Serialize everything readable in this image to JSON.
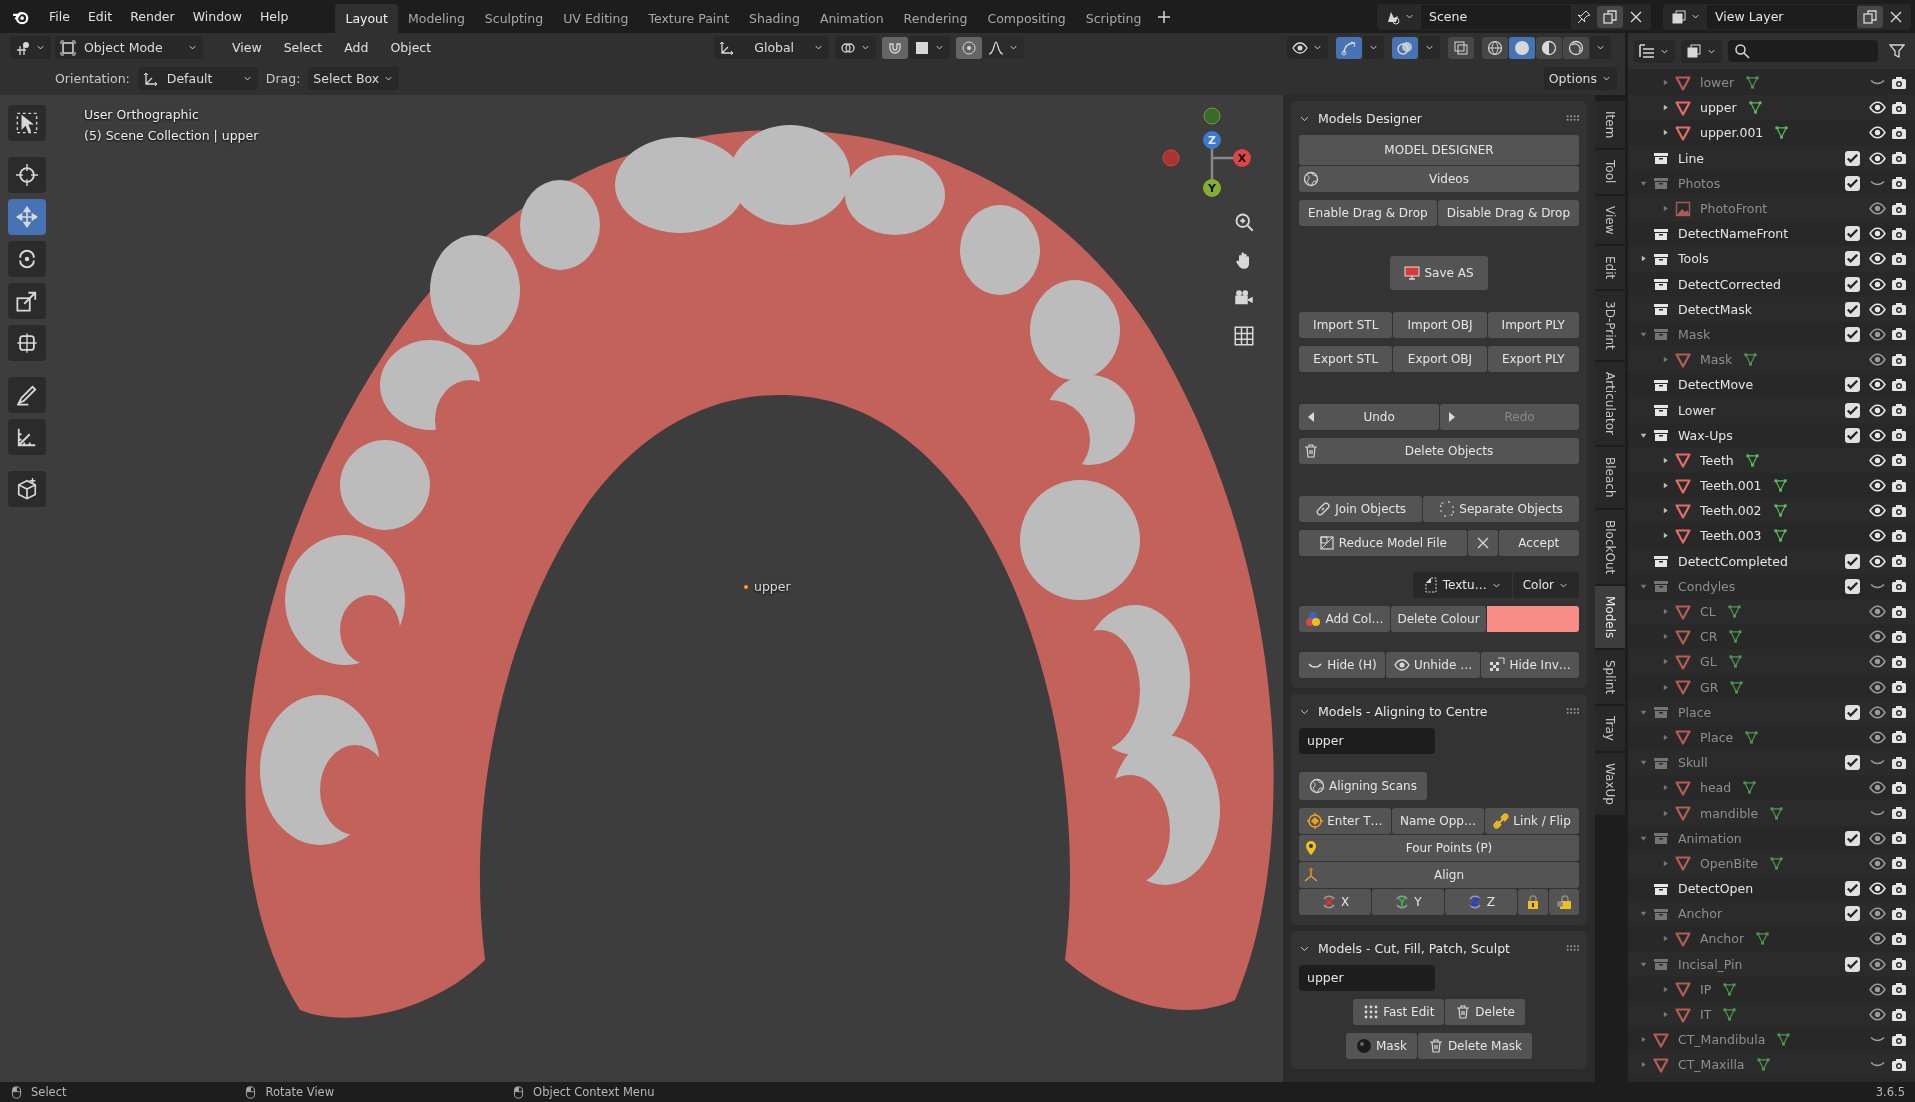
{
  "top_bar": {
    "menus": [
      "File",
      "Edit",
      "Render",
      "Window",
      "Help"
    ],
    "workspaces": [
      {
        "label": "Layout",
        "selected": true
      },
      {
        "label": "Modeling",
        "selected": false
      },
      {
        "label": "Sculpting",
        "selected": false
      },
      {
        "label": "UV Editing",
        "selected": false
      },
      {
        "label": "Texture Paint",
        "selected": false
      },
      {
        "label": "Shading",
        "selected": false
      },
      {
        "label": "Animation",
        "selected": false
      },
      {
        "label": "Rendering",
        "selected": false
      },
      {
        "label": "Compositing",
        "selected": false
      },
      {
        "label": "Scripting",
        "selected": false
      }
    ],
    "scene": "Scene",
    "view_layer": "View Layer"
  },
  "viewport_header": {
    "mode": "Object Mode",
    "menus": [
      "View",
      "Select",
      "Add",
      "Object"
    ],
    "orientation": "Global",
    "gizmos_on": true,
    "overlays_on": true,
    "shading": [
      {
        "selected": false
      },
      {
        "selected": true
      },
      {
        "selected": false
      },
      {
        "selected": false
      }
    ]
  },
  "tool_settings": {
    "orientation_label": "Orientation:",
    "orientation": "Default",
    "drag_label": "Drag:",
    "drag": "Select Box",
    "options": "Options"
  },
  "toolbar": [
    {
      "selected": false
    },
    {
      "selected": false
    },
    {
      "selected": true
    },
    {
      "selected": false
    },
    {
      "selected": false
    },
    {
      "selected": false
    },
    {
      "selected": false
    },
    {
      "selected": false
    },
    {
      "selected": false
    }
  ],
  "viewport": {
    "view_name": "User Orthographic",
    "collection_info": "(5) Scene Collection | upper",
    "object_label": "upper",
    "axes": [
      "Z",
      "X",
      "Y"
    ]
  },
  "n_panel": {
    "sections": [
      {
        "title": "Models Designer",
        "expanded": true,
        "rows": [
          {
            "kind": "stack",
            "rows": [
              [
                {
                  "label": "MODEL DESIGNER"
                }
              ],
              [
                {
                  "label": "Videos"
                }
              ]
            ]
          },
          {
            "kind": "row",
            "buttons": [
              {
                "label": "Enable Drag & Drop"
              },
              {
                "label": "Disable Drag & Drop"
              }
            ]
          },
          {
            "kind": "center",
            "buttons": [
              {
                "label": "Save AS"
              }
            ]
          },
          {
            "kind": "row",
            "buttons": [
              {
                "label": "Import STL"
              },
              {
                "label": "Import OBJ"
              },
              {
                "label": "Import PLY"
              }
            ]
          },
          {
            "kind": "row",
            "buttons": [
              {
                "label": "Export STL"
              },
              {
                "label": "Export OBJ"
              },
              {
                "label": "Export PLY"
              }
            ]
          },
          {
            "kind": "row",
            "buttons": [
              {
                "label": "Undo",
                "disabled": false
              },
              {
                "label": "Redo",
                "disabled": true
              }
            ]
          },
          {
            "kind": "row",
            "buttons": [
              {
                "label": "Delete Objects"
              }
            ]
          },
          {
            "kind": "row",
            "buttons": [
              {
                "label": "Join Objects"
              },
              {
                "label": "Separate Objects"
              }
            ]
          },
          {
            "kind": "row",
            "buttons": [
              {
                "label": "Reduce Model File"
              },
              {
                "kind": "icon"
              },
              {
                "label": "Accept"
              }
            ]
          },
          {
            "kind": "right",
            "buttons": [
              {
                "kind": "dropdown",
                "label": "Textu…"
              },
              {
                "kind": "dropdown",
                "label": "Color"
              }
            ]
          },
          {
            "kind": "row",
            "buttons": [
              {
                "label": "Add Col…"
              },
              {
                "label": "Delete Colour"
              },
              {
                "kind": "swatch",
                "color": "#f88d87"
              }
            ]
          },
          {
            "kind": "row",
            "buttons": [
              {
                "label": "Hide (H)"
              },
              {
                "label": "Unhide …"
              },
              {
                "label": "Hide Inv…"
              }
            ]
          }
        ]
      },
      {
        "title": "Models - Aligning to Centre",
        "expanded": true,
        "rows": [
          {
            "kind": "field",
            "value": "upper"
          },
          {
            "kind": "left",
            "buttons": [
              {
                "label": "Aligning Scans"
              }
            ]
          },
          {
            "kind": "stack",
            "rows": [
              [
                {
                  "label": "Enter T…"
                },
                {
                  "label": "Name Opp…"
                },
                {
                  "label": "Link / Flip"
                }
              ],
              [
                {
                  "label": "Four Points (P)"
                }
              ],
              [
                {
                  "label": "Align"
                }
              ],
              [
                {
                  "label": "X"
                },
                {
                  "label": "Y"
                },
                {
                  "label": "Z"
                },
                {
                  "kind": "icon"
                },
                {
                  "kind": "icon"
                }
              ]
            ]
          }
        ]
      },
      {
        "title": "Models - Cut, Fill, Patch, Sculpt",
        "expanded": true,
        "rows": [
          {
            "kind": "field",
            "value": "upper"
          },
          {
            "kind": "center",
            "buttons": [
              {
                "label": "Fast Edit"
              },
              {
                "label": "Delete"
              }
            ]
          },
          {
            "kind": "center",
            "buttons": [
              {
                "label": "Mask"
              },
              {
                "label": "Delete Mask"
              }
            ]
          }
        ]
      }
    ]
  },
  "side_tabs": [
    {
      "label": "Item",
      "selected": false
    },
    {
      "label": "Tool",
      "selected": false
    },
    {
      "label": "View",
      "selected": false
    },
    {
      "label": "Edit",
      "selected": false
    },
    {
      "label": "3D-Print",
      "selected": false
    },
    {
      "label": "Articulator",
      "selected": false
    },
    {
      "label": "Bleach",
      "selected": false
    },
    {
      "label": "BlockOut",
      "selected": false
    },
    {
      "label": "Models",
      "selected": true
    },
    {
      "label": "Splint",
      "selected": false
    },
    {
      "label": "Tray",
      "selected": false
    },
    {
      "label": "WaxUp",
      "selected": false
    }
  ],
  "outliner": {
    "partial_children": [
      {
        "kind": "mesh",
        "name": "lower",
        "expanded": false,
        "dim": true,
        "visible": false
      },
      {
        "kind": "mesh",
        "name": "upper",
        "expanded": false,
        "dim": false,
        "visible": true
      },
      {
        "kind": "mesh",
        "name": "upper.001",
        "expanded": false,
        "dim": false,
        "visible": true
      }
    ],
    "items": [
      {
        "kind": "collection",
        "name": "Line",
        "checked": true,
        "dim": false,
        "visible": true
      },
      {
        "kind": "collection",
        "name": "Photos",
        "expanded": true,
        "checked": true,
        "dim": true,
        "visible": false,
        "children": [
          {
            "kind": "image",
            "name": "PhotoFront",
            "expanded": false,
            "dim": true,
            "visible": true
          }
        ]
      },
      {
        "kind": "collection",
        "name": "DetectNameFront",
        "checked": true,
        "dim": false,
        "visible": true
      },
      {
        "kind": "collection",
        "name": "Tools",
        "expanded": false,
        "checked": true,
        "dim": false,
        "visible": true
      },
      {
        "kind": "collection",
        "name": "DetectCorrected",
        "checked": true,
        "dim": false,
        "visible": true
      },
      {
        "kind": "collection",
        "name": "DetectMask",
        "checked": true,
        "dim": false,
        "visible": true
      },
      {
        "kind": "collection",
        "name": "Mask",
        "expanded": true,
        "checked": true,
        "dim": true,
        "visible": true,
        "children": [
          {
            "kind": "mesh",
            "name": "Mask",
            "expanded": false,
            "dim": true,
            "visible": true
          }
        ]
      },
      {
        "kind": "collection",
        "name": "DetectMove",
        "checked": true,
        "dim": false,
        "visible": true
      },
      {
        "kind": "collection",
        "name": "Lower",
        "checked": true,
        "dim": false,
        "visible": true
      },
      {
        "kind": "collection",
        "name": "Wax-Ups",
        "expanded": true,
        "checked": true,
        "dim": false,
        "visible": true,
        "children": [
          {
            "kind": "mesh",
            "name": "Teeth",
            "expanded": false,
            "dim": false,
            "visible": true
          },
          {
            "kind": "mesh",
            "name": "Teeth.001",
            "expanded": false,
            "dim": false,
            "visible": true
          },
          {
            "kind": "mesh",
            "name": "Teeth.002",
            "expanded": false,
            "dim": false,
            "visible": true
          },
          {
            "kind": "mesh",
            "name": "Teeth.003",
            "expanded": false,
            "dim": false,
            "visible": true
          }
        ]
      },
      {
        "kind": "collection",
        "name": "DetectCompleted",
        "checked": true,
        "dim": false,
        "visible": true
      },
      {
        "kind": "collection",
        "name": "Condyles",
        "expanded": true,
        "checked": true,
        "dim": true,
        "visible": false,
        "children": [
          {
            "kind": "mesh",
            "name": "CL",
            "expanded": false,
            "dim": true,
            "visible": true
          },
          {
            "kind": "mesh",
            "name": "CR",
            "expanded": false,
            "dim": true,
            "visible": true
          },
          {
            "kind": "mesh",
            "name": "GL",
            "expanded": false,
            "dim": true,
            "visible": true
          },
          {
            "kind": "mesh",
            "name": "GR",
            "expanded": false,
            "dim": true,
            "visible": true
          }
        ]
      },
      {
        "kind": "collection",
        "name": "Place",
        "expanded": true,
        "checked": true,
        "dim": true,
        "visible": true,
        "children": [
          {
            "kind": "mesh",
            "name": "Place",
            "expanded": false,
            "dim": true,
            "visible": true
          }
        ]
      },
      {
        "kind": "collection",
        "name": "Skull",
        "expanded": true,
        "checked": true,
        "dim": true,
        "visible": false,
        "children": [
          {
            "kind": "mesh",
            "name": "head",
            "expanded": false,
            "dim": true,
            "visible": true
          },
          {
            "kind": "mesh",
            "name": "mandible",
            "expanded": false,
            "dim": true,
            "visible": false
          }
        ]
      },
      {
        "kind": "collection",
        "name": "Animation",
        "expanded": true,
        "checked": true,
        "dim": true,
        "visible": true,
        "children": [
          {
            "kind": "mesh",
            "name": "OpenBite",
            "expanded": false,
            "dim": true,
            "visible": true
          }
        ]
      },
      {
        "kind": "collection",
        "name": "DetectOpen",
        "checked": true,
        "dim": false,
        "visible": true
      },
      {
        "kind": "collection",
        "name": "Anchor",
        "expanded": true,
        "checked": true,
        "dim": true,
        "visible": true,
        "children": [
          {
            "kind": "mesh",
            "name": "Anchor",
            "expanded": false,
            "dim": true,
            "visible": true
          }
        ]
      },
      {
        "kind": "collection",
        "name": "Incisal_Pin",
        "expanded": true,
        "checked": true,
        "dim": true,
        "visible": true,
        "children": [
          {
            "kind": "mesh",
            "name": "IP",
            "expanded": false,
            "dim": true,
            "visible": true
          },
          {
            "kind": "mesh",
            "name": "IT",
            "expanded": false,
            "dim": true,
            "visible": true
          }
        ]
      },
      {
        "kind": "mesh",
        "name": "CT_Mandibula",
        "expanded": false,
        "dim": true,
        "visible": false
      },
      {
        "kind": "mesh",
        "name": "CT_Maxilla",
        "expanded": false,
        "dim": true,
        "visible": false
      }
    ]
  },
  "status_bar": {
    "items": [
      "Select",
      "Rotate View",
      "Object Context Menu"
    ],
    "version": "3.6.5"
  }
}
